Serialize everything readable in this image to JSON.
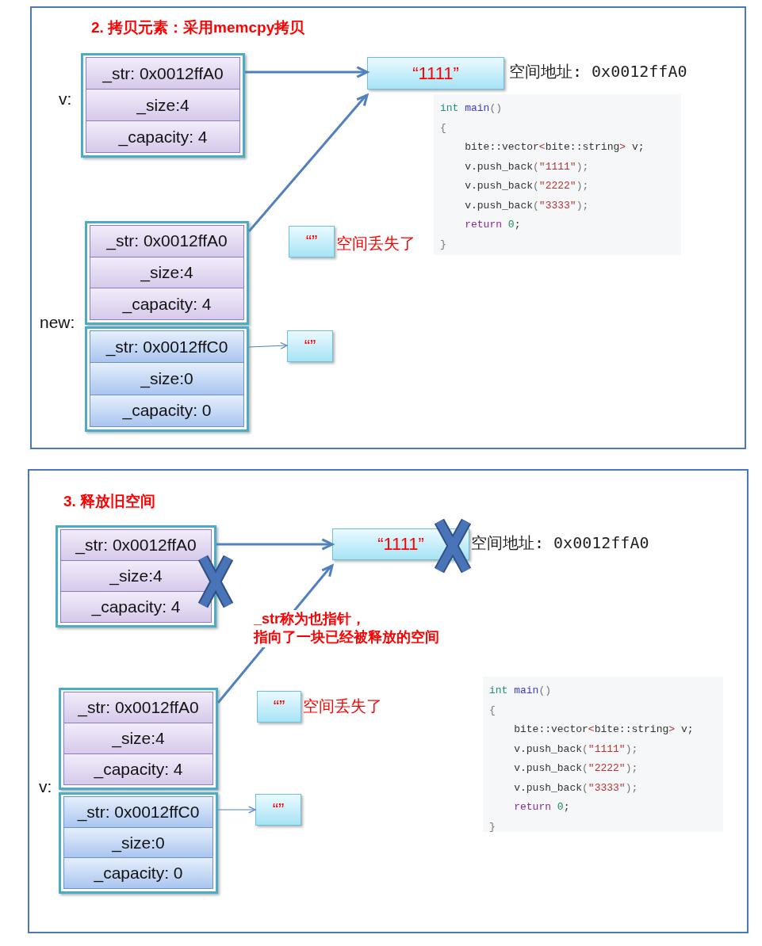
{
  "panels": [
    {
      "title": "2. 拷贝元素：采用memcpy拷贝",
      "blocks": [
        {
          "label": "v:",
          "kind": "old",
          "crossed": false,
          "fields": [
            "_str: 0x0012ffA0",
            "_size:4",
            "_capacity: 4"
          ]
        },
        {
          "kind": "old",
          "crossed": false,
          "fields": [
            "_str: 0x0012ffA0",
            "_size:4",
            "_capacity: 4"
          ]
        },
        {
          "label": "new:",
          "kind": "new",
          "crossed": false,
          "fields": [
            "_str: 0x0012ffC0",
            "_size:0",
            "_capacity: 0"
          ]
        }
      ],
      "strings": [
        {
          "text": "“1111”",
          "crossed": false,
          "note": "空间地址: 0x0012ffA0"
        },
        {
          "text": "“”",
          "crossed": false,
          "note": "空间丢失了"
        },
        {
          "text": "“”",
          "crossed": false
        }
      ],
      "code": [
        [
          {
            "kind": "type",
            "text": "int"
          },
          {
            "kind": "func",
            "text": " main"
          },
          {
            "kind": "punct",
            "text": "()"
          }
        ],
        [
          {
            "kind": "punct",
            "text": "{"
          }
        ],
        [
          {
            "kind": "plain",
            "text": "    bite::vector"
          },
          {
            "kind": "op",
            "text": "<"
          },
          {
            "kind": "plain",
            "text": "bite::string"
          },
          {
            "kind": "op",
            "text": ">"
          },
          {
            "kind": "plain",
            "text": " v;"
          }
        ],
        [
          {
            "kind": "plain",
            "text": "    v.push_back"
          },
          {
            "kind": "punct",
            "text": "("
          },
          {
            "kind": "string",
            "text": "\"1111\""
          },
          {
            "kind": "punct",
            "text": ");"
          }
        ],
        [
          {
            "kind": "plain",
            "text": "    v.push_back"
          },
          {
            "kind": "punct",
            "text": "("
          },
          {
            "kind": "string",
            "text": "\"2222\""
          },
          {
            "kind": "punct",
            "text": ");"
          }
        ],
        [
          {
            "kind": "plain",
            "text": "    v.push_back"
          },
          {
            "kind": "punct",
            "text": "("
          },
          {
            "kind": "string",
            "text": "\"3333\""
          },
          {
            "kind": "punct",
            "text": ");"
          }
        ],
        [
          {
            "kind": "keyword",
            "text": "    return"
          },
          {
            "kind": "number",
            "text": " 0"
          },
          {
            "kind": "plain",
            "text": ";"
          }
        ],
        [
          {
            "kind": "punct",
            "text": "}"
          }
        ]
      ]
    },
    {
      "title": "3. 释放旧空间",
      "blocks": [
        {
          "kind": "old",
          "crossed": true,
          "fields": [
            "_str: 0x0012ffA0",
            "_size:4",
            "_capacity: 4"
          ]
        },
        {
          "kind": "old",
          "crossed": false,
          "fields": [
            "_str: 0x0012ffA0",
            "_size:4",
            "_capacity: 4"
          ]
        },
        {
          "label": "v:",
          "kind": "new",
          "crossed": false,
          "fields": [
            "_str: 0x0012ffC0",
            "_size:0",
            "_capacity: 0"
          ]
        }
      ],
      "strings": [
        {
          "text": "“1111”",
          "crossed": true,
          "note": "空间地址: 0x0012ffA0"
        },
        {
          "text": "“”",
          "crossed": false,
          "note": "空间丢失了"
        },
        {
          "text": "“”",
          "crossed": false
        }
      ],
      "comment": [
        "_str称为也指针，",
        "指向了一块已经被释放的空间"
      ],
      "code": [
        [
          {
            "kind": "type",
            "text": "int"
          },
          {
            "kind": "func",
            "text": " main"
          },
          {
            "kind": "punct",
            "text": "()"
          }
        ],
        [
          {
            "kind": "punct",
            "text": "{"
          }
        ],
        [
          {
            "kind": "plain",
            "text": "    bite::vector"
          },
          {
            "kind": "op",
            "text": "<"
          },
          {
            "kind": "plain",
            "text": "bite::string"
          },
          {
            "kind": "op",
            "text": ">"
          },
          {
            "kind": "plain",
            "text": " v;"
          }
        ],
        [
          {
            "kind": "plain",
            "text": "    v.push_back"
          },
          {
            "kind": "punct",
            "text": "("
          },
          {
            "kind": "string",
            "text": "\"1111\""
          },
          {
            "kind": "punct",
            "text": ");"
          }
        ],
        [
          {
            "kind": "plain",
            "text": "    v.push_back"
          },
          {
            "kind": "punct",
            "text": "("
          },
          {
            "kind": "string",
            "text": "\"2222\""
          },
          {
            "kind": "punct",
            "text": ");"
          }
        ],
        [
          {
            "kind": "plain",
            "text": "    v.push_back"
          },
          {
            "kind": "punct",
            "text": "("
          },
          {
            "kind": "string",
            "text": "\"3333\""
          },
          {
            "kind": "punct",
            "text": ");"
          }
        ],
        [
          {
            "kind": "keyword",
            "text": "    return"
          },
          {
            "kind": "number",
            "text": " 0"
          },
          {
            "kind": "plain",
            "text": ";"
          }
        ],
        [
          {
            "kind": "punct",
            "text": "}"
          }
        ]
      ]
    }
  ]
}
